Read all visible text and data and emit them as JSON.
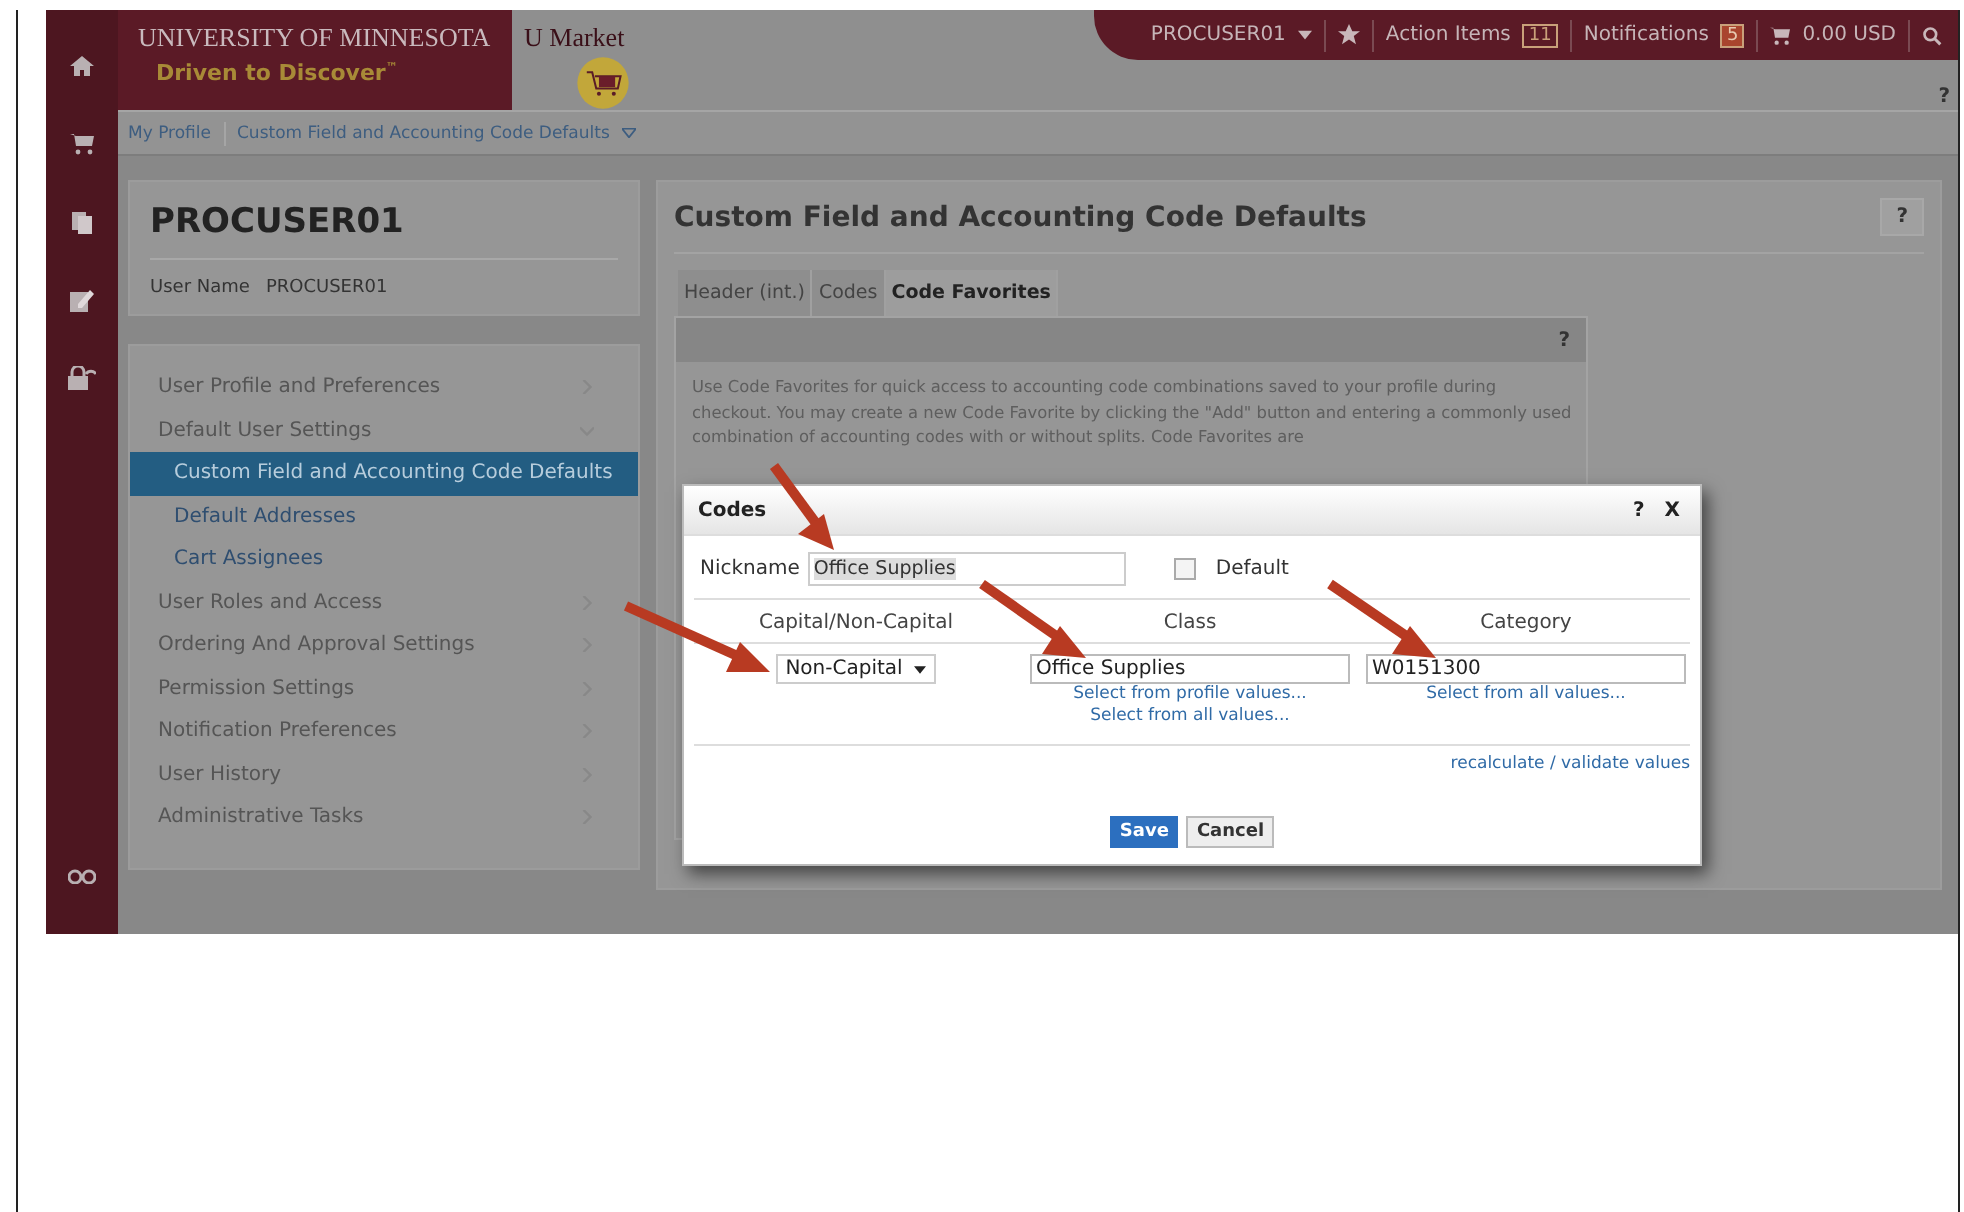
{
  "header": {
    "university": "UNIVERSITY OF MINNESOTA",
    "tagline": "Driven to Discover$^{™}$",
    "app_name": "U Market",
    "user_menu": "PROCUSER01",
    "action_items": {
      "label": "Action Items",
      "count": "11"
    },
    "notifications": {
      "label": "Notifications",
      "count": "5"
    },
    "cart_total": "0.00 USD",
    "help": "?"
  },
  "breadcrumb": [
    "My Profile",
    "Custom Field and Accounting Code Defaults"
  ],
  "profile": {
    "name": "PROCUSER01",
    "user_name_label": "User Name",
    "user_name": "PROCUSER01"
  },
  "sidebar": {
    "items": [
      {
        "label": "User Profile and Preferences",
        "expanded": false,
        "selected": false
      },
      {
        "label": "Default User Settings",
        "expanded": true,
        "selected": false,
        "children": [
          {
            "label": "Custom Field and Accounting Code Defaults",
            "selected": true
          },
          {
            "label": "Default Addresses",
            "selected": false
          },
          {
            "label": "Cart Assignees",
            "selected": false
          }
        ]
      },
      {
        "label": "User Roles and Access",
        "expanded": false,
        "selected": false
      },
      {
        "label": "Ordering And Approval Settings",
        "expanded": false,
        "selected": false
      },
      {
        "label": "Permission Settings",
        "expanded": false,
        "selected": false
      },
      {
        "label": "Notification Preferences",
        "expanded": false,
        "selected": false
      },
      {
        "label": "User History",
        "expanded": false,
        "selected": false
      },
      {
        "label": "Administrative Tasks",
        "expanded": false,
        "selected": false
      }
    ]
  },
  "panel": {
    "title": "Custom Field and Accounting Code Defaults",
    "help": "?",
    "tabs": [
      {
        "label": "Header (int.)",
        "selected": false
      },
      {
        "label": "Codes",
        "selected": false
      },
      {
        "label": "Code Favorites",
        "selected": true
      }
    ],
    "subheader_help": "?",
    "description": "Use Code Favorites for quick access to accounting code combinations saved to your profile during checkout. You may create a new Code Favorite by clicking the \"Add\" button and entering a commonly used combination of accounting codes with or without splits. Code Favorites are"
  },
  "dialog": {
    "title": "Codes",
    "help": "?",
    "close": "X",
    "nickname_label": "Nickname",
    "nickname": "Office Supplies",
    "default": {
      "label": "Default",
      "checked": false
    },
    "columns": [
      {
        "header": "Capital/Non-Capital",
        "kind": "select",
        "value": "Non-Capital"
      },
      {
        "header": "Class",
        "kind": "text",
        "value": "Office Supplies",
        "links": [
          "Select from profile values...",
          "Select from all values..."
        ]
      },
      {
        "header": "Category",
        "kind": "text",
        "value": "W0151300",
        "links": [
          "Select from all values..."
        ]
      }
    ],
    "recalculate": "recalculate / validate values",
    "buttons": [
      {
        "label": "Save",
        "kind": "primary"
      },
      {
        "label": "Cancel",
        "kind": "secondary"
      }
    ]
  }
}
